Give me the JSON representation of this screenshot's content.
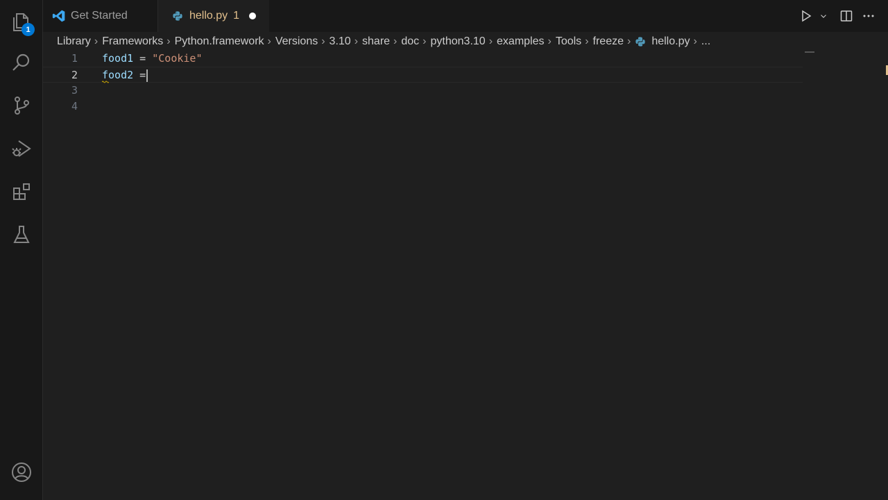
{
  "tabs": {
    "get_started_label": "Get Started",
    "hello_label": "hello.py",
    "hello_problems": "1"
  },
  "activity_bar": {
    "explorer_badge": "1",
    "icons": [
      "files-icon",
      "search-icon",
      "source-control-icon",
      "run-debug-icon",
      "extensions-icon",
      "testing-icon",
      "account-icon"
    ]
  },
  "breadcrumbs": [
    "Library",
    "Frameworks",
    "Python.framework",
    "Versions",
    "3.10",
    "share",
    "doc",
    "python3.10",
    "examples",
    "Tools",
    "freeze",
    "hello.py",
    "..."
  ],
  "editor": {
    "lines": [
      {
        "number": "1",
        "var": "food1",
        "op": " = ",
        "str": "\"Cookie\""
      },
      {
        "number": "2",
        "var": "food2",
        "op": " =",
        "str": ""
      },
      {
        "number": "3",
        "var": "",
        "op": "",
        "str": ""
      },
      {
        "number": "4",
        "var": "",
        "op": "",
        "str": ""
      }
    ]
  },
  "colors": {
    "accent": "#0078d4",
    "modified_tab": "#e2c08d",
    "string": "#ce9178",
    "variable": "#9cdcfe"
  }
}
